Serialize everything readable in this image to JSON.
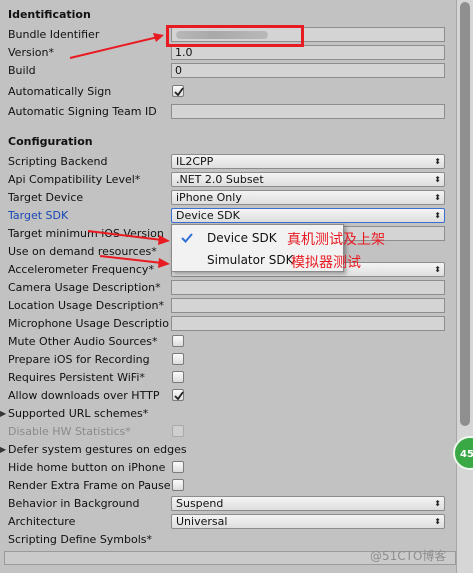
{
  "sections": {
    "identification": "Identification",
    "configuration": "Configuration"
  },
  "identification": {
    "bundle_identifier_label": "Bundle Identifier",
    "version_label": "Version*",
    "version_value": "1.0",
    "build_label": "Build",
    "build_value": "0",
    "auto_sign_label": "Automatically Sign",
    "auto_sign_checked": true,
    "team_id_label": "Automatic Signing Team ID"
  },
  "configuration": {
    "scripting_backend": {
      "label": "Scripting Backend",
      "value": "IL2CPP"
    },
    "api_compat": {
      "label": "Api Compatibility Level*",
      "value": ".NET 2.0 Subset"
    },
    "target_device": {
      "label": "Target Device",
      "value": "iPhone Only"
    },
    "target_sdk": {
      "label": "Target SDK",
      "value": "Device SDK"
    },
    "target_min_ios": {
      "label": "Target minimum iOS Version"
    },
    "on_demand": {
      "label": "Use on demand resources*"
    },
    "accelerometer": {
      "label": "Accelerometer Frequency*"
    },
    "camera_desc": {
      "label": "Camera Usage Description*"
    },
    "location_desc": {
      "label": "Location Usage Description*"
    },
    "mic_desc": {
      "label": "Microphone Usage Description*"
    },
    "mute_audio": {
      "label": "Mute Other Audio Sources*",
      "checked": false
    },
    "prepare_ios": {
      "label": "Prepare iOS for Recording",
      "checked": false
    },
    "persistent_wifi": {
      "label": "Requires Persistent WiFi*",
      "checked": false
    },
    "allow_http": {
      "label": "Allow downloads over HTTP",
      "checked": true
    },
    "url_schemes": {
      "label": "Supported URL schemes*"
    },
    "hw_stats": {
      "label": "Disable HW Statistics*",
      "checked": false
    },
    "defer_gestures": {
      "label": "Defer system gestures on edges"
    },
    "hide_home": {
      "label": "Hide home button on iPhone",
      "checked": false
    },
    "extra_frame": {
      "label": "Render Extra Frame on Pause",
      "checked": false
    },
    "background": {
      "label": "Behavior in Background",
      "value": "Suspend"
    },
    "architecture": {
      "label": "Architecture",
      "value": "Universal"
    },
    "define_symbols": {
      "label": "Scripting Define Symbols*"
    }
  },
  "popup": {
    "options": [
      "Device SDK",
      "Simulator SDK"
    ],
    "selected": "Device SDK"
  },
  "annotations": {
    "device_note": "真机测试及上架",
    "simulator_note": "模拟器测试",
    "color": "#e81a22"
  },
  "badge": "45",
  "watermark": "@51CTO博客",
  "icons": {
    "dropdown": "updown-chevron-icon",
    "check": "checkmark-icon",
    "fold": "fold-triangle-icon"
  }
}
